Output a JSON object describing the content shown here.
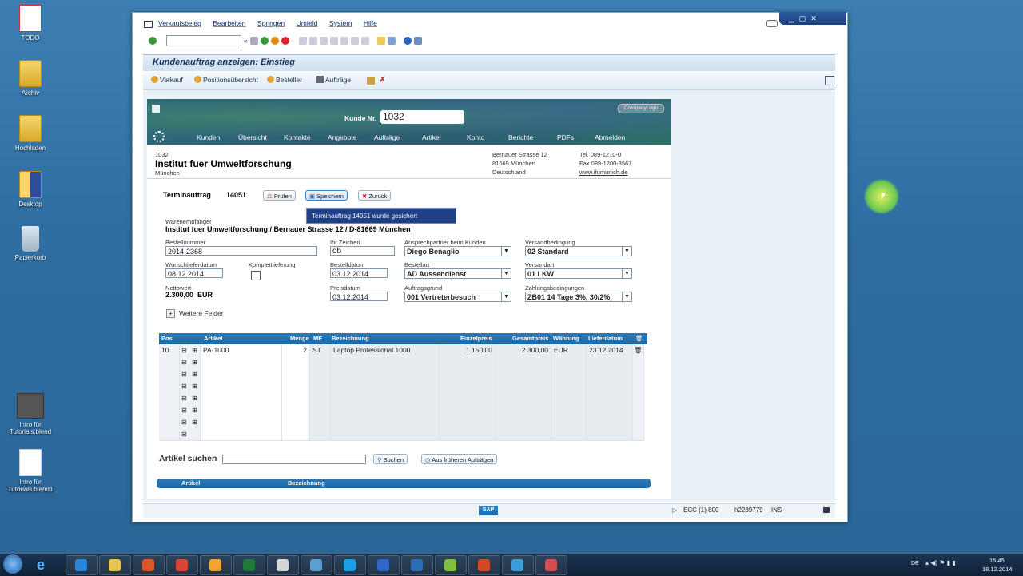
{
  "desktop": {
    "icons": [
      "TODO",
      "Archiv",
      "Hochladen",
      "Desktop",
      "Papierkorb",
      "Intro für Tutorials.blend",
      "Intro für Tutorials.blend1"
    ]
  },
  "sap": {
    "menu": [
      "Verkaufsbeleg",
      "Bearbeiten",
      "Springen",
      "Umfeld",
      "System",
      "Hilfe"
    ],
    "title": "Kundenauftrag anzeigen: Einstieg",
    "apptools": [
      "Verkauf",
      "Positionsübersicht",
      "Besteller",
      "Aufträge"
    ],
    "status": {
      "system": "ECC (1) 800",
      "server": "h2289779",
      "mode": "INS"
    }
  },
  "portal": {
    "kunde_label": "Kunde Nr.",
    "kunde_value": "1032",
    "logo": "CompanyLogo",
    "nav": [
      "Kunden",
      "Übersicht",
      "Kontakte",
      "Angebote",
      "Aufträge",
      "Artikel",
      "Konto",
      "Berichte",
      "PDFs",
      "Abmelden"
    ],
    "customer": {
      "nr": "1032",
      "name": "Institut fuer Umweltforschung",
      "city": "München",
      "street": "Bernauer Strasse 12",
      "zip_city": "81669 München",
      "country": "Deutschland",
      "tel": "Tel. 089-1210-0",
      "fax": "Fax 089-1200-3567",
      "web": "www.ifumunich.de"
    }
  },
  "order": {
    "title": "Terminauftrag",
    "number": "14051",
    "btn_pruefen": "Prüfen",
    "btn_speichern": "Speichern",
    "btn_zurueck": "Zurück",
    "toast": "Terminauftrag 14051 wurde gesichert",
    "warenempfaenger_label": "Warenempfänger",
    "warenempfaenger": "Institut fuer Umweltforschung / Bernauer Strasse 12 / D-81669 München",
    "bestellnummer_label": "Bestellnummer",
    "bestellnummer": "2014-2368",
    "ihr_zeichen_label": "Ihr Zeichen",
    "ihr_zeichen": "db",
    "ansprech_label": "Ansprechpartner beim Kunden",
    "ansprech": "Diego Benaglio",
    "versandbed_label": "Versandbedingung",
    "versandbed": "02 Standard",
    "wunsch_label": "Wunschlieferdatum",
    "wunsch": "08.12.2014",
    "komplett_label": "Komplettlieferung",
    "bestelldatum_label": "Bestelldatum",
    "bestelldatum": "03.12.2014",
    "bestellart_label": "Bestellart",
    "bestellart": "AD Aussendienst",
    "versandart_label": "Versandart",
    "versandart": "01 LKW",
    "netto_label": "Nettowert",
    "netto": "2.300,00  EUR",
    "preisdatum_label": "Preisdatum",
    "preisdatum": "03.12.2014",
    "grund_label": "Auftragsgrund",
    "grund": "001 Vertreterbesuch",
    "zahlung_label": "Zahlungsbedingungen",
    "zahlung": "ZB01 14 Tage 3%, 30/2%,",
    "weitere": "Weitere Felder"
  },
  "table": {
    "headers": [
      "Pos",
      "Artikel",
      "Menge",
      "ME",
      "Bezeichnung",
      "Einzelpreis",
      "Gesamtpreis",
      "Währung",
      "Lieferdatum"
    ],
    "rows": [
      {
        "pos": "10",
        "artikel": "PA-1000",
        "menge": "2",
        "me": "ST",
        "bez": "Laptop Professional 1000",
        "einzel": "1.150,00",
        "gesamt": "2.300,00",
        "waehrung": "EUR",
        "liefer": "23.12.2014"
      }
    ]
  },
  "search": {
    "label": "Artikel suchen",
    "btn": "Suchen",
    "btn2": "Aus früheren Aufträgen",
    "cols": [
      "Artikel",
      "Bezeichnung"
    ]
  },
  "taskbar": {
    "lang": "DE",
    "time": "15:45",
    "date": "18.12.2014"
  }
}
